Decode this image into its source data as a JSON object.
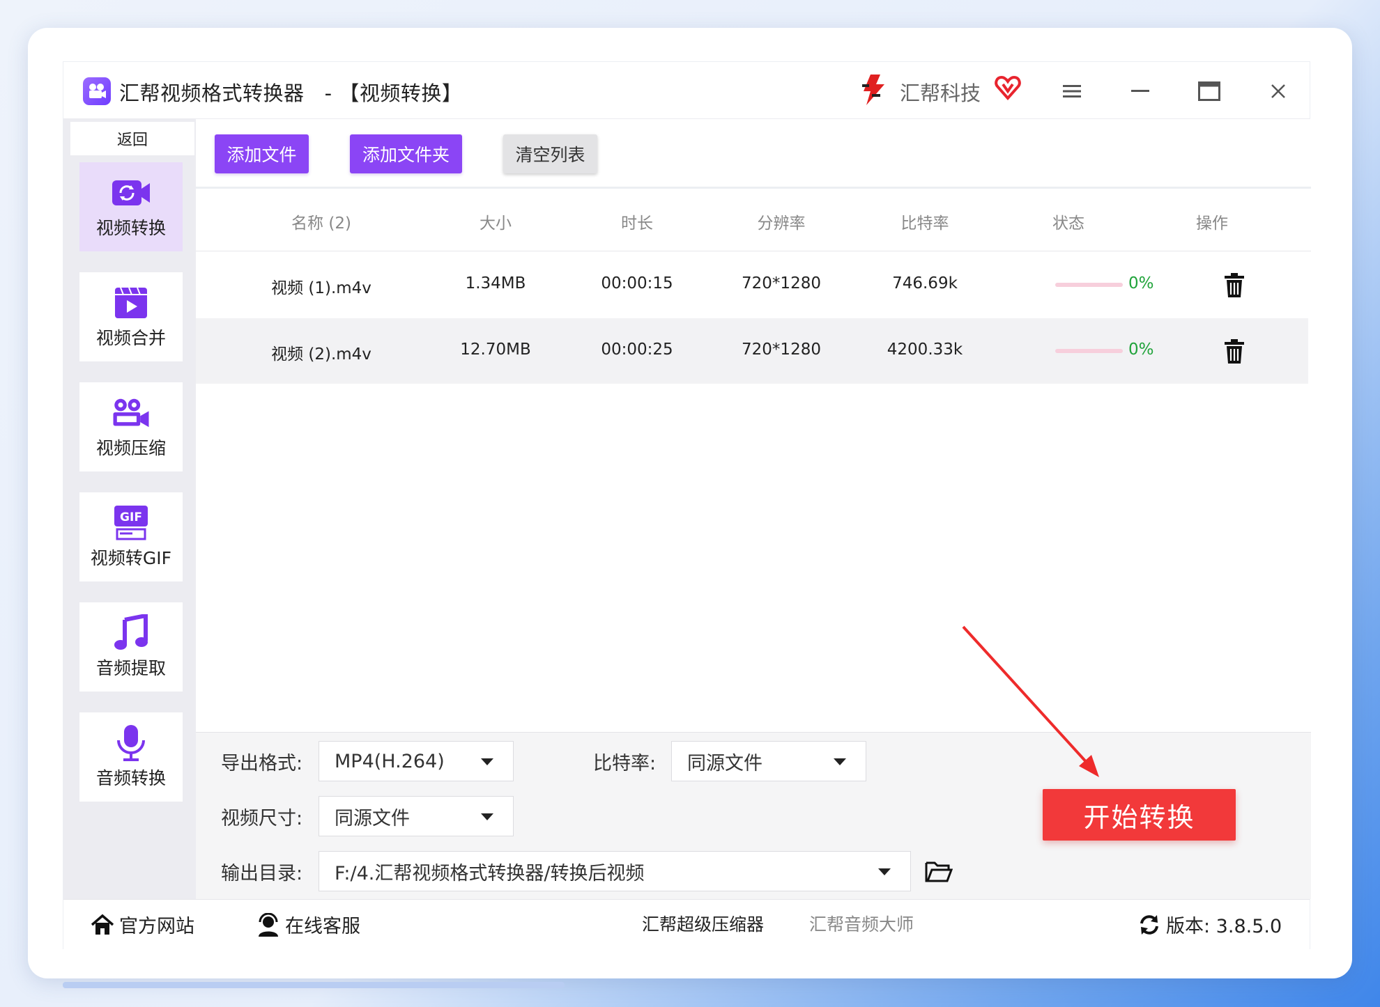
{
  "window": {
    "title": "汇帮视频格式转换器",
    "title_section": "-  【视频转换】",
    "brand_name": "汇帮科技"
  },
  "sidebar": {
    "back_label": "返回",
    "items": [
      {
        "label": "视频转换",
        "icon": "video-convert-icon",
        "active": true
      },
      {
        "label": "视频合并",
        "icon": "video-merge-icon",
        "active": false
      },
      {
        "label": "视频压缩",
        "icon": "video-compress-icon",
        "active": false
      },
      {
        "label": "视频转GIF",
        "icon": "gif-icon",
        "active": false
      },
      {
        "label": "音频提取",
        "icon": "music-note-icon",
        "active": false
      },
      {
        "label": "音频转换",
        "icon": "microphone-icon",
        "active": false
      }
    ]
  },
  "toolbar": {
    "add_file": "添加文件",
    "add_folder": "添加文件夹",
    "clear_list": "清空列表"
  },
  "table": {
    "headers": [
      "名称 (2)",
      "大小",
      "时长",
      "分辨率",
      "比特率",
      "状态",
      "操作"
    ],
    "rows": [
      {
        "name": "视频 (1).m4v",
        "size": "1.34MB",
        "duration": "00:00:15",
        "resolution": "720*1280",
        "bitrate": "746.69k",
        "progress": 0,
        "progress_text": "0%"
      },
      {
        "name": "视频 (2).m4v",
        "size": "12.70MB",
        "duration": "00:00:25",
        "resolution": "720*1280",
        "bitrate": "4200.33k",
        "progress": 0,
        "progress_text": "0%"
      }
    ]
  },
  "settings": {
    "format_label": "导出格式:",
    "format_value": "MP4(H.264)",
    "bitrate_label": "比特率:",
    "bitrate_value": "同源文件",
    "size_label": "视频尺寸:",
    "size_value": "同源文件",
    "output_label": "输出目录:",
    "output_value": "F:/4.汇帮视频格式转换器/转换后视频",
    "start_label": "开始转换"
  },
  "footer": {
    "website": "官方网站",
    "support": "在线客服",
    "compressor": "汇帮超级压缩器",
    "audio_master": "汇帮音频大师",
    "version": "版本:  3.8.5.0"
  },
  "colors": {
    "accent_purple": "#8b45f5",
    "start_red": "#f2393a",
    "progress_green": "#20a33a",
    "active_nav_bg": "#e9dcfa"
  }
}
